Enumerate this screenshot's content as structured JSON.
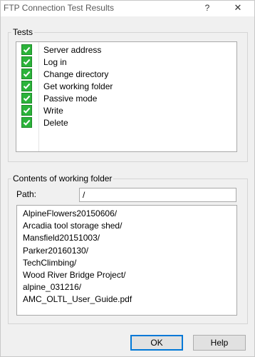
{
  "window": {
    "title": "FTP Connection Test Results",
    "help_glyph": "?",
    "close_glyph": "✕"
  },
  "tests": {
    "group_label": "Tests",
    "items": [
      {
        "label": "Server address",
        "status": "passed",
        "icon": "green-check-icon"
      },
      {
        "label": "Log in",
        "status": "passed",
        "icon": "green-check-icon"
      },
      {
        "label": "Change directory",
        "status": "passed",
        "icon": "green-check-icon"
      },
      {
        "label": "Get working folder",
        "status": "passed",
        "icon": "green-check-icon"
      },
      {
        "label": "Passive mode",
        "status": "passed",
        "icon": "green-check-icon"
      },
      {
        "label": "Write",
        "status": "passed",
        "icon": "green-check-icon"
      },
      {
        "label": "Delete",
        "status": "passed",
        "icon": "green-check-icon"
      }
    ]
  },
  "folder": {
    "group_label": "Contents of working folder",
    "path_label": "Path:",
    "path_value": "/",
    "items": [
      "AlpineFlowers20150606/",
      "Arcadia tool storage shed/",
      "Mansfield20151003/",
      "Parker20160130/",
      "TechClimbing/",
      "Wood River Bridge Project/",
      "alpine_031216/",
      "AMC_OLTL_User_Guide.pdf"
    ]
  },
  "buttons": {
    "ok_label": "OK",
    "help_label": "Help"
  },
  "colors": {
    "check_green": "#2bb33a",
    "focus_blue": "#0078d7"
  }
}
